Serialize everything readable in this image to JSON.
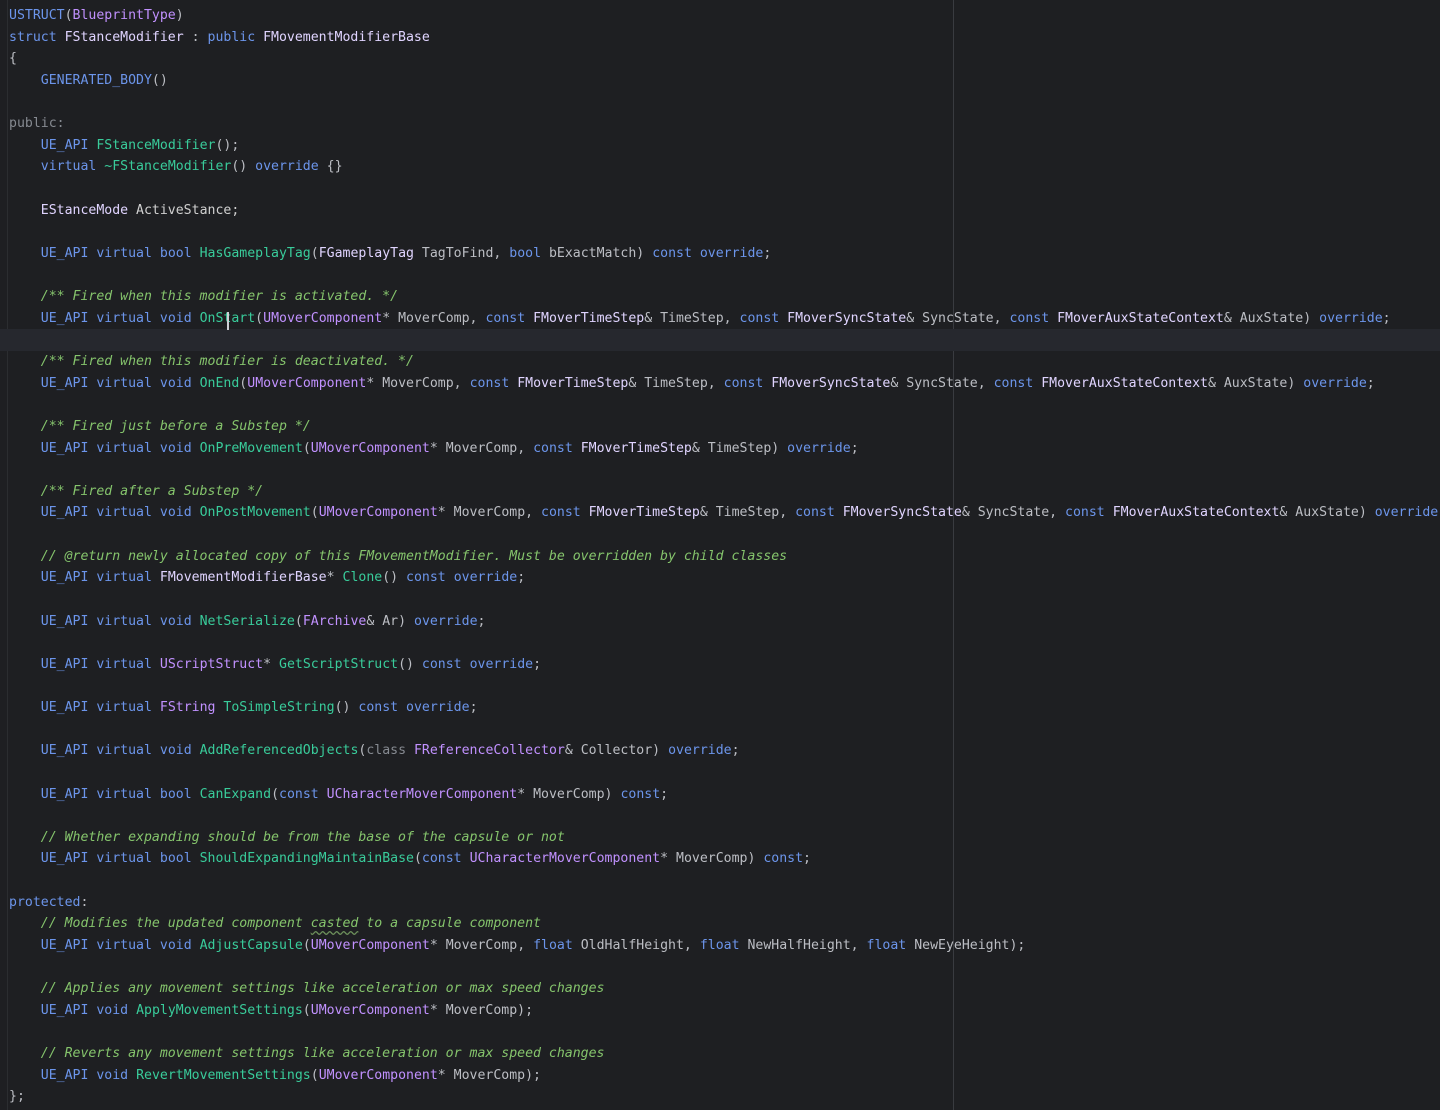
{
  "editor": {
    "colors": {
      "background": "#1e1f22",
      "keyword": "#6c95eb",
      "type": "#c191ff",
      "function": "#39cc9b",
      "comment": "#85c46c",
      "plain": "#bcbec4"
    },
    "current_line": 15,
    "lines": [
      [
        [
          "USTRUCT",
          "macro"
        ],
        [
          "(",
          "plain"
        ],
        [
          "BlueprintType",
          "type"
        ],
        [
          ")",
          "plain"
        ]
      ],
      [
        [
          "struct ",
          "keyword"
        ],
        [
          "FStanceModifier",
          "struct"
        ],
        [
          " : ",
          "plain"
        ],
        [
          "public ",
          "keyword"
        ],
        [
          "FMovementModifierBase",
          "struct"
        ]
      ],
      [
        [
          "{",
          "plain"
        ]
      ],
      [
        [
          "    ",
          "plain"
        ],
        [
          "GENERATED_BODY",
          "macro"
        ],
        [
          "()",
          "plain"
        ]
      ],
      [],
      [
        [
          "public",
          "dim"
        ],
        [
          ":",
          "dim"
        ]
      ],
      [
        [
          "    ",
          "plain"
        ],
        [
          "UE_API",
          "macro"
        ],
        [
          " ",
          "plain"
        ],
        [
          "FStanceModifier",
          "func"
        ],
        [
          "();",
          "plain"
        ]
      ],
      [
        [
          "    ",
          "plain"
        ],
        [
          "virtual ",
          "keyword"
        ],
        [
          "~FStanceModifier",
          "func"
        ],
        [
          "() ",
          "plain"
        ],
        [
          "override",
          "keyword"
        ],
        [
          " {}",
          "plain"
        ]
      ],
      [],
      [
        [
          "    ",
          "plain"
        ],
        [
          "EStanceMode",
          "struct"
        ],
        [
          " ActiveStance;",
          "ident"
        ]
      ],
      [],
      [
        [
          "    ",
          "plain"
        ],
        [
          "UE_API",
          "macro"
        ],
        [
          " ",
          "plain"
        ],
        [
          "virtual ",
          "keyword"
        ],
        [
          "bool ",
          "keyword"
        ],
        [
          "HasGameplayTag",
          "func"
        ],
        [
          "(",
          "plain"
        ],
        [
          "FGameplayTag",
          "struct"
        ],
        [
          " TagToFind, ",
          "param"
        ],
        [
          "bool ",
          "keyword"
        ],
        [
          "bExactMatch) ",
          "param"
        ],
        [
          "const ",
          "keyword"
        ],
        [
          "override",
          "keyword"
        ],
        [
          ";",
          "plain"
        ]
      ],
      [],
      [
        [
          "    ",
          "plain"
        ],
        [
          "/** Fired when this modifier is activated. */",
          "comment"
        ]
      ],
      [
        [
          "    ",
          "plain"
        ],
        [
          "UE_API",
          "macro"
        ],
        [
          " ",
          "plain"
        ],
        [
          "virtual ",
          "keyword"
        ],
        [
          "void ",
          "keyword"
        ],
        [
          "OnStart",
          "func"
        ],
        [
          "(",
          "plain"
        ],
        [
          "UMoverComponent",
          "type"
        ],
        [
          "* MoverComp, ",
          "param"
        ],
        [
          "const ",
          "keyword"
        ],
        [
          "FMoverTimeStep",
          "struct"
        ],
        [
          "& TimeStep, ",
          "param"
        ],
        [
          "const ",
          "keyword"
        ],
        [
          "FMoverSyncState",
          "struct"
        ],
        [
          "& SyncState, ",
          "param"
        ],
        [
          "const ",
          "keyword"
        ],
        [
          "FMoverAuxStateContext",
          "struct"
        ],
        [
          "& AuxState) ",
          "param"
        ],
        [
          "override",
          "keyword"
        ],
        [
          ";",
          "plain"
        ]
      ],
      [],
      [
        [
          "    ",
          "plain"
        ],
        [
          "/** Fired when this modifier is deactivated. */",
          "comment"
        ]
      ],
      [
        [
          "    ",
          "plain"
        ],
        [
          "UE_API",
          "macro"
        ],
        [
          " ",
          "plain"
        ],
        [
          "virtual ",
          "keyword"
        ],
        [
          "void ",
          "keyword"
        ],
        [
          "OnEnd",
          "func"
        ],
        [
          "(",
          "plain"
        ],
        [
          "UMoverComponent",
          "type"
        ],
        [
          "* MoverComp, ",
          "param"
        ],
        [
          "const ",
          "keyword"
        ],
        [
          "FMoverTimeStep",
          "struct"
        ],
        [
          "& TimeStep, ",
          "param"
        ],
        [
          "const ",
          "keyword"
        ],
        [
          "FMoverSyncState",
          "struct"
        ],
        [
          "& SyncState, ",
          "param"
        ],
        [
          "const ",
          "keyword"
        ],
        [
          "FMoverAuxStateContext",
          "struct"
        ],
        [
          "& AuxState) ",
          "param"
        ],
        [
          "override",
          "keyword"
        ],
        [
          ";",
          "plain"
        ]
      ],
      [],
      [
        [
          "    ",
          "plain"
        ],
        [
          "/** Fired just before a Substep */",
          "comment"
        ]
      ],
      [
        [
          "    ",
          "plain"
        ],
        [
          "UE_API",
          "macro"
        ],
        [
          " ",
          "plain"
        ],
        [
          "virtual ",
          "keyword"
        ],
        [
          "void ",
          "keyword"
        ],
        [
          "OnPreMovement",
          "func"
        ],
        [
          "(",
          "plain"
        ],
        [
          "UMoverComponent",
          "type"
        ],
        [
          "* MoverComp, ",
          "param"
        ],
        [
          "const ",
          "keyword"
        ],
        [
          "FMoverTimeStep",
          "struct"
        ],
        [
          "& TimeStep) ",
          "param"
        ],
        [
          "override",
          "keyword"
        ],
        [
          ";",
          "plain"
        ]
      ],
      [],
      [
        [
          "    ",
          "plain"
        ],
        [
          "/** Fired after a Substep */",
          "comment"
        ]
      ],
      [
        [
          "    ",
          "plain"
        ],
        [
          "UE_API",
          "macro"
        ],
        [
          " ",
          "plain"
        ],
        [
          "virtual ",
          "keyword"
        ],
        [
          "void ",
          "keyword"
        ],
        [
          "OnPostMovement",
          "func"
        ],
        [
          "(",
          "plain"
        ],
        [
          "UMoverComponent",
          "type"
        ],
        [
          "* MoverComp, ",
          "param"
        ],
        [
          "const ",
          "keyword"
        ],
        [
          "FMoverTimeStep",
          "struct"
        ],
        [
          "& TimeStep, ",
          "param"
        ],
        [
          "const ",
          "keyword"
        ],
        [
          "FMoverSyncState",
          "struct"
        ],
        [
          "& SyncState, ",
          "param"
        ],
        [
          "const ",
          "keyword"
        ],
        [
          "FMoverAuxStateContext",
          "struct"
        ],
        [
          "& AuxState) ",
          "param"
        ],
        [
          "override",
          "keyword"
        ],
        [
          ";",
          "plain"
        ]
      ],
      [],
      [
        [
          "    ",
          "plain"
        ],
        [
          "// @return newly allocated copy of this FMovementModifier. Must be overridden by child classes",
          "comment"
        ]
      ],
      [
        [
          "    ",
          "plain"
        ],
        [
          "UE_API",
          "macro"
        ],
        [
          " ",
          "plain"
        ],
        [
          "virtual ",
          "keyword"
        ],
        [
          "FMovementModifierBase",
          "struct"
        ],
        [
          "* ",
          "plain"
        ],
        [
          "Clone",
          "func"
        ],
        [
          "() ",
          "plain"
        ],
        [
          "const ",
          "keyword"
        ],
        [
          "override",
          "keyword"
        ],
        [
          ";",
          "plain"
        ]
      ],
      [],
      [
        [
          "    ",
          "plain"
        ],
        [
          "UE_API",
          "macro"
        ],
        [
          " ",
          "plain"
        ],
        [
          "virtual ",
          "keyword"
        ],
        [
          "void ",
          "keyword"
        ],
        [
          "NetSerialize",
          "func"
        ],
        [
          "(",
          "plain"
        ],
        [
          "FArchive",
          "type"
        ],
        [
          "& Ar) ",
          "param"
        ],
        [
          "override",
          "keyword"
        ],
        [
          ";",
          "plain"
        ]
      ],
      [],
      [
        [
          "    ",
          "plain"
        ],
        [
          "UE_API",
          "macro"
        ],
        [
          " ",
          "plain"
        ],
        [
          "virtual ",
          "keyword"
        ],
        [
          "UScriptStruct",
          "type"
        ],
        [
          "* ",
          "plain"
        ],
        [
          "GetScriptStruct",
          "func"
        ],
        [
          "() ",
          "plain"
        ],
        [
          "const ",
          "keyword"
        ],
        [
          "override",
          "keyword"
        ],
        [
          ";",
          "plain"
        ]
      ],
      [],
      [
        [
          "    ",
          "plain"
        ],
        [
          "UE_API",
          "macro"
        ],
        [
          " ",
          "plain"
        ],
        [
          "virtual ",
          "keyword"
        ],
        [
          "FString",
          "type"
        ],
        [
          " ",
          "plain"
        ],
        [
          "ToSimpleString",
          "func"
        ],
        [
          "() ",
          "plain"
        ],
        [
          "const ",
          "keyword"
        ],
        [
          "override",
          "keyword"
        ],
        [
          ";",
          "plain"
        ]
      ],
      [],
      [
        [
          "    ",
          "plain"
        ],
        [
          "UE_API",
          "macro"
        ],
        [
          " ",
          "plain"
        ],
        [
          "virtual ",
          "keyword"
        ],
        [
          "void ",
          "keyword"
        ],
        [
          "AddReferencedObjects",
          "func"
        ],
        [
          "(",
          "plain"
        ],
        [
          "class ",
          "dim"
        ],
        [
          "FReferenceCollector",
          "type"
        ],
        [
          "& Collector) ",
          "param"
        ],
        [
          "override",
          "keyword"
        ],
        [
          ";",
          "plain"
        ]
      ],
      [],
      [
        [
          "    ",
          "plain"
        ],
        [
          "UE_API",
          "macro"
        ],
        [
          " ",
          "plain"
        ],
        [
          "virtual ",
          "keyword"
        ],
        [
          "bool ",
          "keyword"
        ],
        [
          "CanExpand",
          "func"
        ],
        [
          "(",
          "plain"
        ],
        [
          "const ",
          "keyword"
        ],
        [
          "UCharacterMoverComponent",
          "type"
        ],
        [
          "* MoverComp) ",
          "param"
        ],
        [
          "const",
          "keyword"
        ],
        [
          ";",
          "plain"
        ]
      ],
      [],
      [
        [
          "    ",
          "plain"
        ],
        [
          "// Whether expanding should be from the base of the capsule or not",
          "comment"
        ]
      ],
      [
        [
          "    ",
          "plain"
        ],
        [
          "UE_API",
          "macro"
        ],
        [
          " ",
          "plain"
        ],
        [
          "virtual ",
          "keyword"
        ],
        [
          "bool ",
          "keyword"
        ],
        [
          "ShouldExpandingMaintainBase",
          "func"
        ],
        [
          "(",
          "plain"
        ],
        [
          "const ",
          "keyword"
        ],
        [
          "UCharacterMoverComponent",
          "type"
        ],
        [
          "* MoverComp) ",
          "param"
        ],
        [
          "const",
          "keyword"
        ],
        [
          ";",
          "plain"
        ]
      ],
      [],
      [
        [
          "protected",
          "keyword"
        ],
        [
          ":",
          "plain"
        ]
      ],
      [
        [
          "    ",
          "plain"
        ],
        [
          "// Modifies the updated component ",
          "comment"
        ],
        [
          "casted",
          "comment typo"
        ],
        [
          " to a capsule component",
          "comment"
        ]
      ],
      [
        [
          "    ",
          "plain"
        ],
        [
          "UE_API",
          "macro"
        ],
        [
          " ",
          "plain"
        ],
        [
          "virtual ",
          "keyword"
        ],
        [
          "void ",
          "keyword"
        ],
        [
          "AdjustCapsule",
          "func"
        ],
        [
          "(",
          "plain"
        ],
        [
          "UMoverComponent",
          "type"
        ],
        [
          "* MoverComp, ",
          "param"
        ],
        [
          "float ",
          "keyword"
        ],
        [
          "OldHalfHeight, ",
          "param"
        ],
        [
          "float ",
          "keyword"
        ],
        [
          "NewHalfHeight, ",
          "param"
        ],
        [
          "float ",
          "keyword"
        ],
        [
          "NewEyeHeight);",
          "param"
        ]
      ],
      [],
      [
        [
          "    ",
          "plain"
        ],
        [
          "// Applies any movement settings like acceleration or max speed changes",
          "comment"
        ]
      ],
      [
        [
          "    ",
          "plain"
        ],
        [
          "UE_API",
          "macro"
        ],
        [
          " ",
          "plain"
        ],
        [
          "void ",
          "keyword"
        ],
        [
          "ApplyMovementSettings",
          "func"
        ],
        [
          "(",
          "plain"
        ],
        [
          "UMoverComponent",
          "type"
        ],
        [
          "* MoverComp);",
          "param"
        ]
      ],
      [],
      [
        [
          "    ",
          "plain"
        ],
        [
          "// Reverts any movement settings like acceleration or max speed changes",
          "comment"
        ]
      ],
      [
        [
          "    ",
          "plain"
        ],
        [
          "UE_API",
          "macro"
        ],
        [
          " ",
          "plain"
        ],
        [
          "void ",
          "keyword"
        ],
        [
          "RevertMovementSettings",
          "func"
        ],
        [
          "(",
          "plain"
        ],
        [
          "UMoverComponent",
          "type"
        ],
        [
          "* MoverComp);",
          "param"
        ]
      ],
      [
        [
          "};",
          "plain"
        ]
      ]
    ]
  }
}
